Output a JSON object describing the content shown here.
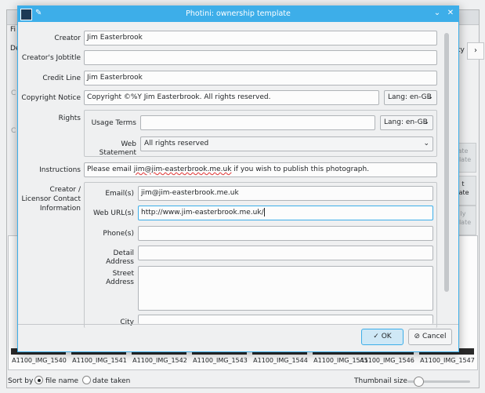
{
  "dialog": {
    "title": "Photini: ownership template",
    "ok_label": "OK",
    "cancel_label": "Cancel"
  },
  "fields": {
    "creator_label": "Creator",
    "creator_value": "Jim Easterbrook",
    "jobtitle_label": "Creator's Jobtitle",
    "jobtitle_value": "",
    "credit_label": "Credit Line",
    "credit_value": "Jim Easterbrook",
    "copyright_label": "Copyright Notice",
    "copyright_value": "Copyright ©%Y Jim Easterbrook. All rights reserved.",
    "copyright_lang": "Lang: en-GB",
    "rights_label": "Rights",
    "usage_label": "Usage Terms",
    "usage_value": "",
    "usage_lang": "Lang: en-GB",
    "webstatement_label": "Web Statement",
    "webstatement_value": "All rights reserved",
    "instructions_label": "Instructions",
    "instructions_pre": "Please email ",
    "instructions_email": "jim@jim-easterbrook.me.uk",
    "instructions_post": " if you wish to publish this photograph.",
    "contact_label_1": "Creator /",
    "contact_label_2": "Licensor Contact",
    "contact_label_3": "Information",
    "emails_label": "Email(s)",
    "emails_value": "jim@jim-easterbrook.me.uk",
    "weburls_label": "Web URL(s)",
    "weburls_value": "http://www.jim-easterbrook.me.uk/",
    "phones_label": "Phone(s)",
    "phones_value": "",
    "detail_label": "Detail Address",
    "detail_value": "",
    "street_label": "Street Address",
    "street_value": "",
    "city_label": "City",
    "city_value": ""
  },
  "background": {
    "menu_fragment": "Fi",
    "tab_fragment": "De",
    "side_fragment_a": "C",
    "side_fragment_b": "C",
    "side_tab_fragment": "ty",
    "right_buttons": [
      "ate\nplate",
      "t\nlate",
      "ly\nplate"
    ],
    "thumbnails": [
      "A1100_IMG_1540",
      "A1100_IMG_1541",
      "A1100_IMG_1542",
      "A1100_IMG_1543",
      "A1100_IMG_1544",
      "A1100_IMG_1545",
      "A1100_IMG_1546",
      "A1100_IMG_1547"
    ],
    "sort_label": "Sort by",
    "sort_option_1": "file name",
    "sort_option_2": "date taken",
    "thumb_size_label": "Thumbnail size"
  },
  "colors": {
    "accent": "#3daee9",
    "window_bg": "#eff0f1"
  }
}
